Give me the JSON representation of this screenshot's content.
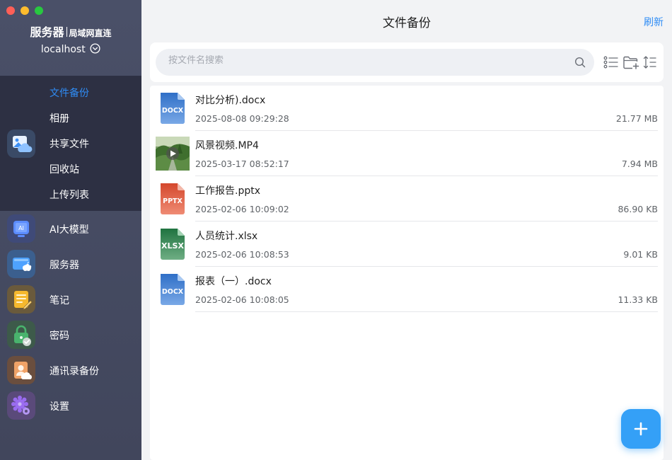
{
  "sidebar": {
    "brand_main": "服务器",
    "brand_sub": "局域网直连",
    "host": "localhost",
    "file_section": {
      "items": [
        {
          "label": "文件备份",
          "active": true
        },
        {
          "label": "相册",
          "active": false
        },
        {
          "label": "共享文件",
          "active": false
        },
        {
          "label": "回收站",
          "active": false
        },
        {
          "label": "上传列表",
          "active": false
        }
      ]
    },
    "nav": [
      {
        "label": "AI大模型",
        "icon": "ai-model-icon"
      },
      {
        "label": "服务器",
        "icon": "server-icon"
      },
      {
        "label": "笔记",
        "icon": "notes-icon"
      },
      {
        "label": "密码",
        "icon": "password-lock-icon"
      },
      {
        "label": "通讯录备份",
        "icon": "contacts-backup-icon"
      },
      {
        "label": "设置",
        "icon": "settings-gear-icon"
      }
    ]
  },
  "header": {
    "title": "文件备份",
    "refresh_label": "刷新"
  },
  "search": {
    "placeholder": "按文件名搜索",
    "value": ""
  },
  "files": [
    {
      "name": "对比分析).docx",
      "date": "2025-08-08 09:29:28",
      "size": "21.77 MB",
      "type": "DOCX",
      "color": "#3f7ac9"
    },
    {
      "name": "风景视频.MP4",
      "date": "2025-03-17 08:52:17",
      "size": "7.94 MB",
      "type": "video",
      "color": "#4d7a3a"
    },
    {
      "name": "工作报告.pptx",
      "date": "2025-02-06 10:09:02",
      "size": "86.90 KB",
      "type": "PPTX",
      "color": "#d9553b"
    },
    {
      "name": "人员统计.xlsx",
      "date": "2025-02-06 10:08:53",
      "size": "9.01 KB",
      "type": "XLSX",
      "color": "#2e7f4f"
    },
    {
      "name": "报表（一）.docx",
      "date": "2025-02-06 10:08:05",
      "size": "11.33 KB",
      "type": "DOCX",
      "color": "#3f7ac9"
    }
  ],
  "colors": {
    "accent": "#2f8cf5",
    "sidebar_bg": "#474c63",
    "sidebar_section_bg": "#2d3043",
    "fab": "#34a0f7"
  }
}
